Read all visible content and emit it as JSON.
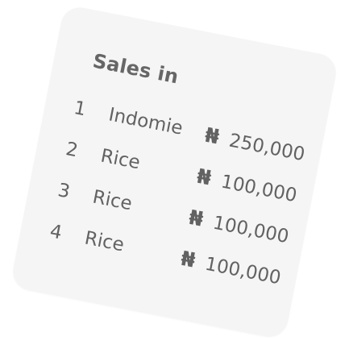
{
  "card": {
    "title": "Sales in"
  },
  "sales": [
    {
      "number": "1",
      "name": "Indomie",
      "currency_symbol": "₦",
      "amount": "250,000"
    },
    {
      "number": "2",
      "name": "Rice",
      "currency_symbol": "₦",
      "amount": "100,000"
    },
    {
      "number": "3",
      "name": "Rice",
      "currency_symbol": "₦",
      "amount": "100,000"
    },
    {
      "number": "4",
      "name": "Rice",
      "currency_symbol": "₦",
      "amount": "100,000"
    }
  ],
  "colors": {
    "card_background": "#f5f5f5",
    "text": "#626262",
    "page_background": "#ffffff"
  }
}
